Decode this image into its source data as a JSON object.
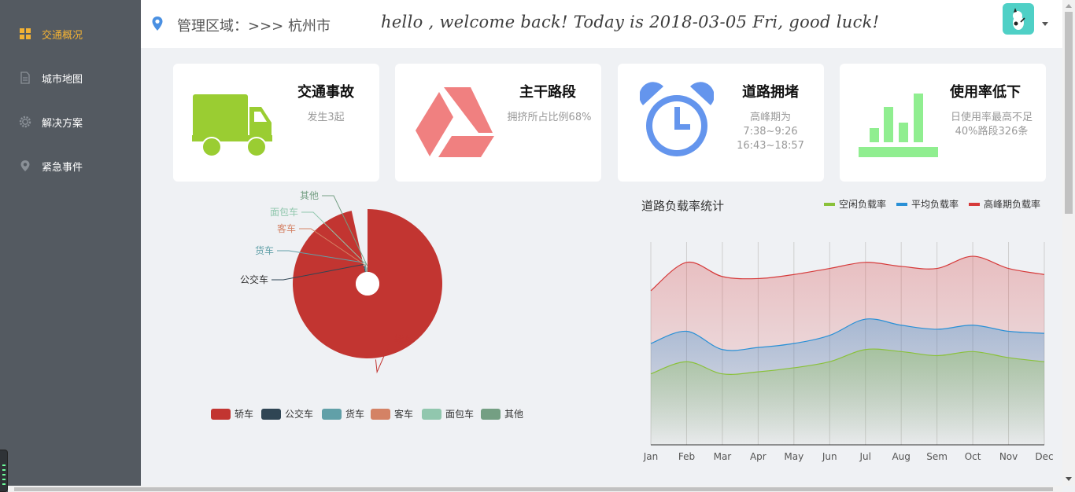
{
  "sidebar": {
    "items": [
      {
        "label": "交通概况",
        "icon": "grid-icon",
        "active": true
      },
      {
        "label": "城市地图",
        "icon": "document-icon",
        "active": false
      },
      {
        "label": "解决方案",
        "icon": "gear-icon",
        "active": false
      },
      {
        "label": "紧急事件",
        "icon": "location-pin-icon",
        "active": false
      }
    ]
  },
  "header": {
    "region": "管理区域：>>> 杭州市",
    "welcome": "hello , welcome back! Today is 2018-03-05 Fri, good luck!"
  },
  "cards": [
    {
      "title": "交通事故",
      "desc": [
        "发生3起"
      ],
      "icon": "truck-icon",
      "color": "#9acd32"
    },
    {
      "title": "主干路段",
      "desc": [
        "拥挤所占比例68%"
      ],
      "icon": "drive-triangle-icon",
      "color": "#f08080"
    },
    {
      "title": "道路拥堵",
      "desc": [
        "高峰期为",
        "7:38~9:26",
        "16:43~18:57"
      ],
      "icon": "alarm-clock-icon",
      "color": "#6495ed"
    },
    {
      "title": "使用率低下",
      "desc": [
        "日使用率最高不足",
        "40%路段326条"
      ],
      "icon": "bar-chart-icon",
      "color": "#90ee90"
    }
  ],
  "chart_data": [
    {
      "type": "pie",
      "categories": [
        "轿车",
        "公交车",
        "货车",
        "客车",
        "面包车",
        "其他"
      ],
      "values": [
        240,
        2,
        3,
        1,
        1.5,
        1
      ],
      "colors": [
        "#c23531",
        "#2f4554",
        "#61a0a8",
        "#d48265",
        "#91c7ae",
        "#749f83"
      ],
      "legend_position": "bottom"
    },
    {
      "type": "area",
      "title": "道路负载率统计",
      "categories": [
        "Jan",
        "Feb",
        "Mar",
        "Apr",
        "May",
        "Jun",
        "Jul",
        "Aug",
        "Sem",
        "Oct",
        "Nov",
        "Dec"
      ],
      "series": [
        {
          "name": "空闲负载率",
          "color": "#8ac13a",
          "values": [
            35,
            41,
            35,
            36,
            38,
            41,
            47,
            46,
            44,
            46,
            43,
            41
          ]
        },
        {
          "name": "平均负载率",
          "color": "#2990d6",
          "values": [
            50,
            56,
            47,
            48,
            50,
            54,
            62,
            59,
            57,
            59,
            56,
            55
          ]
        },
        {
          "name": "高峰期负载率",
          "color": "#d63a3a",
          "values": [
            76,
            90,
            83,
            82,
            84,
            87,
            90,
            88,
            87,
            93,
            87,
            84
          ]
        }
      ],
      "ylim": [
        0,
        100
      ],
      "grid": true,
      "legend_position": "top-right"
    }
  ]
}
